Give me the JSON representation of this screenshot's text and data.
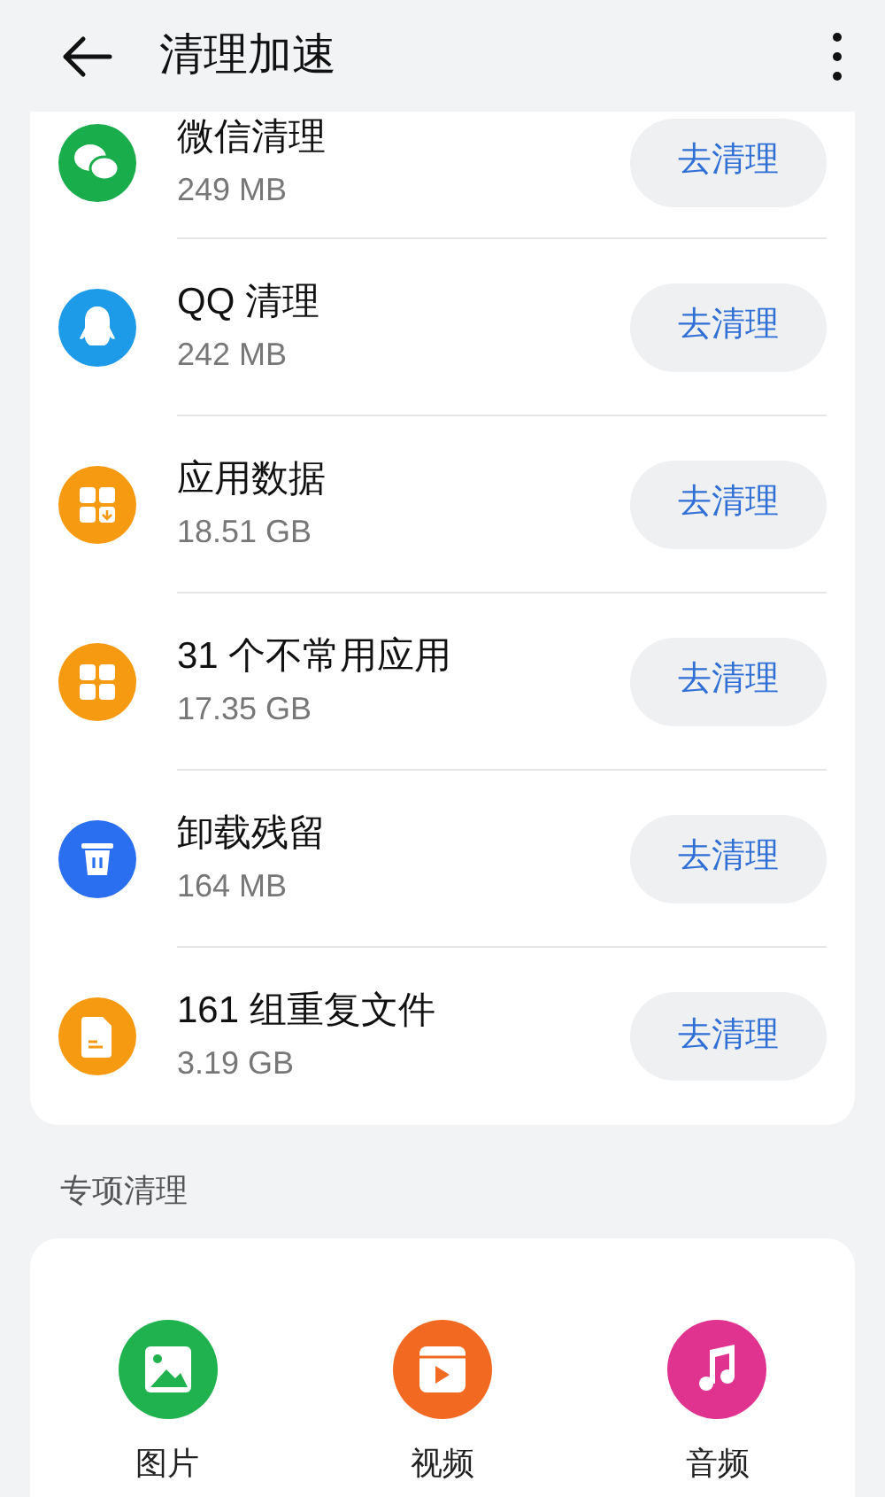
{
  "header": {
    "title": "清理加速"
  },
  "items": [
    {
      "kind": "wechat",
      "title": "微信清理",
      "size": "249 MB",
      "button": "去清理"
    },
    {
      "kind": "qq",
      "title": "QQ 清理",
      "size": "242 MB",
      "button": "去清理"
    },
    {
      "kind": "app-data",
      "title": "应用数据",
      "size": "18.51 GB",
      "button": "去清理"
    },
    {
      "kind": "apps",
      "title": "31 个不常用应用",
      "size": "17.35 GB",
      "button": "去清理"
    },
    {
      "kind": "trash",
      "title": "卸载残留",
      "size": "164 MB",
      "button": "去清理"
    },
    {
      "kind": "file",
      "title": "161 组重复文件",
      "size": "3.19 GB",
      "button": "去清理"
    }
  ],
  "special": {
    "title": "专项清理",
    "items": [
      {
        "kind": "image",
        "label": "图片"
      },
      {
        "kind": "video",
        "label": "视频"
      },
      {
        "kind": "music",
        "label": "音频"
      }
    ]
  }
}
